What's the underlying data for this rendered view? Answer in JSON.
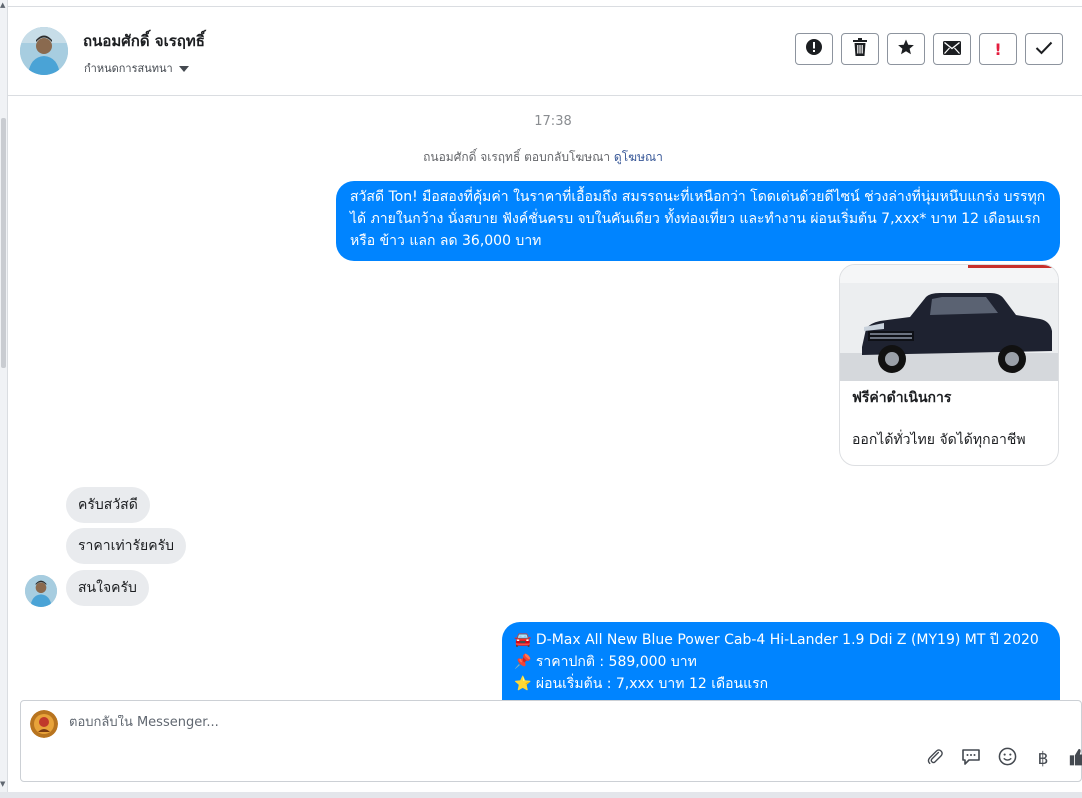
{
  "header": {
    "contact_name": "ถนอมศักดิ์ จเรฤทธิ์",
    "contact_sub": "กำหนดการสนทนา",
    "actions": [
      {
        "icon": "exclamation-circle-icon"
      },
      {
        "icon": "trash-icon"
      },
      {
        "icon": "star-icon"
      },
      {
        "icon": "envelope-icon"
      },
      {
        "icon": "exclamation-mark-icon",
        "label": "!"
      },
      {
        "icon": "check-icon"
      }
    ]
  },
  "conversation": {
    "timestamp": "17:38",
    "ad_note": {
      "text": "ถนอมศักดิ์ จเรฤทธิ์ ตอบกลับโฆษณา",
      "link": "ดูโฆษณา"
    },
    "outgoing_1": "สวัสดี Ton! มือสองที่คุ้มค่า ในราคาที่เอื้อมถึง สมรรถนะที่เหนือกว่า โดดเด่นด้วยดีไซน์ ช่วงล่างที่นุ่มหนึบแกร่ง บรรทุกได้ ภายในกว้าง นั่งสบาย ฟังค์ชั่นครบ จบในคันเดียว ทั้งท่องเที่ยว และทำงาน ผ่อนเริ่มต้น 7,xxx* บาท 12 เดือนแรก หรือ ข้าว แลก ลด 36,000 บาท",
    "card": {
      "title": "ฟรีค่าดำเนินการ",
      "description": "ออกได้ทั่วไทย จัดได้ทุกอาชีพ"
    },
    "incoming": [
      "ครับสวัสดี",
      "ราคาเท่ารัยครับ",
      "สนใจครับ"
    ],
    "outgoing_2_lines": [
      "🚘 D-Max All New Blue Power Cab-4 Hi-Lander 1.9 Ddi Z (MY19) MT ปี 2020",
      "📌 ราคาปกติ : 589,000 บาท",
      "⭐ ผ่อนเริ่มต้น : 7,xxx บาท 12 เดือนแรก"
    ]
  },
  "composer": {
    "placeholder": "ตอบกลับใน Messenger...",
    "tools": [
      "paperclip-icon",
      "chat-bubble-icon",
      "smiley-icon",
      "baht-icon",
      "thumbs-up-icon"
    ],
    "baht_symbol": "฿"
  },
  "colors": {
    "outgoing_bubble": "#0084ff",
    "incoming_bubble": "#e9ebee",
    "link": "#385898",
    "alert_red": "#e41e3f"
  }
}
